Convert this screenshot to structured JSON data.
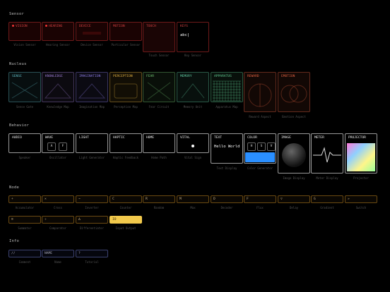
{
  "sections": {
    "sensor": "Sensor",
    "nucleus": "Nucleus",
    "behavior": "Behavior",
    "node": "Node",
    "info": "Info"
  },
  "sensor": [
    {
      "title": "VISION",
      "caption": "Vision Sensor",
      "dot": true,
      "color": "#d04040"
    },
    {
      "title": "HEARING",
      "caption": "Hearing Sensor",
      "dot": true,
      "color": "#d04040"
    },
    {
      "title": "DEVICE",
      "caption": "Device Sensor",
      "dot": false,
      "color": "#d04040"
    },
    {
      "title": "MOTION",
      "caption": "Particular Sensor",
      "dot": false,
      "color": "#d04040"
    },
    {
      "title": "TOUCH",
      "caption": "Touch Sensor",
      "dot": false,
      "color": "#d04040"
    },
    {
      "title": "KEYS",
      "caption": "Key Sensor",
      "dot": false,
      "color": "#d04040",
      "value": "abc|"
    }
  ],
  "nucleus": [
    {
      "title": "SENSE",
      "caption": "Sense Gate",
      "color": "#5fb8c0"
    },
    {
      "title": "KNOWLEDGE",
      "caption": "Knowledge Map",
      "color": "#9a7ad0"
    },
    {
      "title": "IMAGINATION",
      "caption": "Imagination Map",
      "color": "#8a7ae0"
    },
    {
      "title": "PERCEPTION",
      "caption": "Perception Map",
      "color": "#e0b040"
    },
    {
      "title": "FEAR",
      "caption": "Fear Circuit",
      "color": "#70c070"
    },
    {
      "title": "MEMORY",
      "caption": "Memory Unit",
      "color": "#60c8a0"
    },
    {
      "title": "APPARATUS",
      "caption": "Apparatus Map",
      "color": "#60c890"
    },
    {
      "title": "REWARD",
      "caption": "Reward Aspect",
      "color": "#e06040"
    },
    {
      "title": "EMOTION",
      "caption": "Emotion Aspect",
      "color": "#e06040"
    }
  ],
  "behavior": [
    {
      "title": "AUDIO",
      "caption": "Speaker"
    },
    {
      "title": "WAVE",
      "caption": "Oscillator",
      "buttons": [
        "A",
        "F"
      ]
    },
    {
      "title": "LIGHT",
      "caption": "Light Generator"
    },
    {
      "title": "HAPTIC",
      "caption": "Haptic Feedback"
    },
    {
      "title": "HOME",
      "caption": "Home Path"
    },
    {
      "title": "VITAL",
      "caption": "Vital Sign"
    },
    {
      "title": "TEXT",
      "caption": "Text Display",
      "value": "Hello World"
    },
    {
      "title": "COLOR",
      "caption": "Color Generator",
      "buttons": [
        "H",
        "S",
        "V"
      ]
    },
    {
      "title": "IMAGE",
      "caption": "Image Display"
    },
    {
      "title": "METER",
      "caption": "Meter Display"
    },
    {
      "title": "PROJECTOR",
      "caption": "Projector"
    }
  ],
  "node_row1": [
    {
      "sym": "+",
      "caption": "Accumulator"
    },
    {
      "sym": "×",
      "caption": "Cross"
    },
    {
      "sym": "~",
      "caption": "Inverter"
    },
    {
      "sym": "C",
      "caption": "Counter"
    },
    {
      "sym": "R",
      "caption": "Random"
    },
    {
      "sym": "M",
      "caption": "Max"
    },
    {
      "sym": "D",
      "caption": "Decoder"
    },
    {
      "sym": "F",
      "caption": "Flux"
    },
    {
      "sym": "▽",
      "caption": "Delay"
    },
    {
      "sym": "G",
      "caption": "Gradient"
    },
    {
      "sym": "»",
      "caption": "Switch"
    }
  ],
  "node_row2": [
    {
      "sym": "≡",
      "caption": "Summator"
    },
    {
      "sym": "÷",
      "caption": "Comparator"
    },
    {
      "sym": "∆",
      "caption": "Differentiator"
    },
    {
      "sym": "IO",
      "caption": "Input Output",
      "active": true
    }
  ],
  "info": [
    {
      "sym": "//",
      "caption": "Comment"
    },
    {
      "sym": "NAME",
      "caption": "Name"
    },
    {
      "sym": "?",
      "caption": "Tutorial"
    }
  ]
}
